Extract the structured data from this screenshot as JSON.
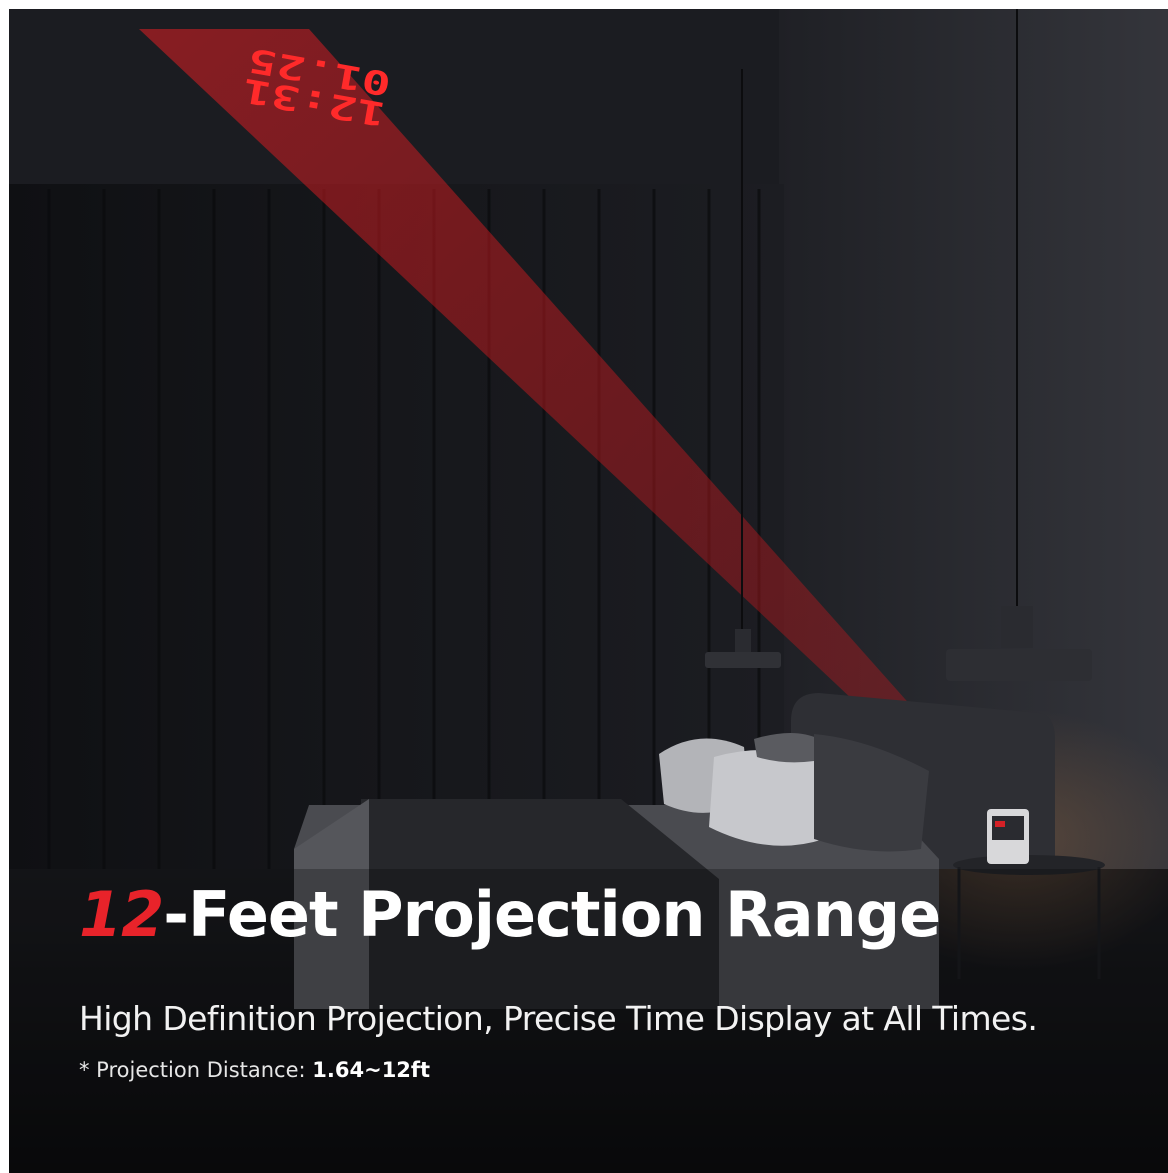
{
  "headline": {
    "number": "12",
    "rest": "-Feet Projection Range"
  },
  "subheadline": "High Definition Projection, Precise Time Display at All Times.",
  "note": {
    "label": "* Projection Distance: ",
    "value": "1.64~12ft"
  },
  "projection": {
    "time": "12:31",
    "date": "01.25"
  },
  "colors": {
    "accent": "#e8232a",
    "background": "#15161a",
    "text": "#ffffff"
  }
}
